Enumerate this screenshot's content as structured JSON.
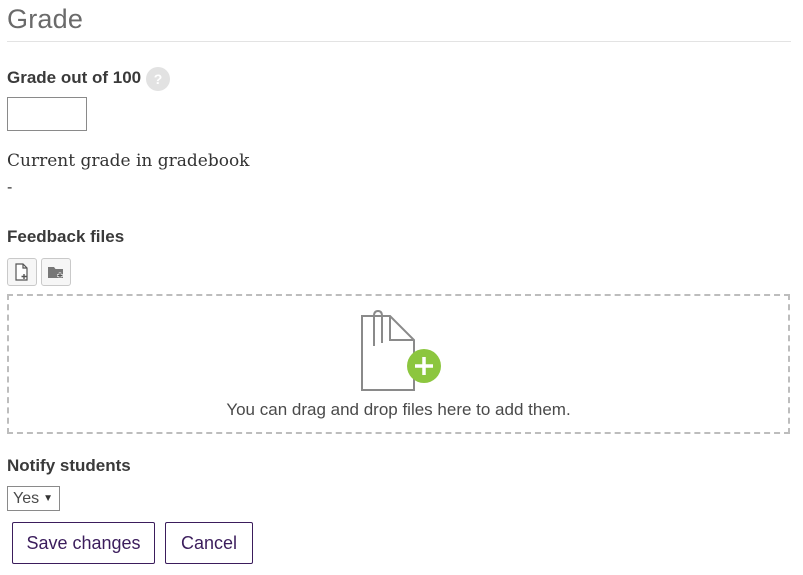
{
  "section": {
    "title": "Grade"
  },
  "grade": {
    "label": "Grade out of 100",
    "help_icon": "question-mark-icon",
    "help_glyph": "?",
    "input_value": ""
  },
  "current_grade": {
    "label": "Current grade in gradebook",
    "value": "-"
  },
  "feedback_files": {
    "label": "Feedback files",
    "add_file_icon": "add-file-icon",
    "create_folder_icon": "create-folder-icon",
    "dropzone_icon": "file-upload-icon",
    "dropzone_text": "You can drag and drop files here to add them."
  },
  "notify": {
    "label": "Notify students",
    "selected": "Yes",
    "options": [
      "Yes"
    ]
  },
  "actions": {
    "save_label": "Save changes",
    "cancel_label": "Cancel"
  },
  "colors": {
    "accent": "#3b1d5c",
    "add_green": "#8cc63f"
  }
}
